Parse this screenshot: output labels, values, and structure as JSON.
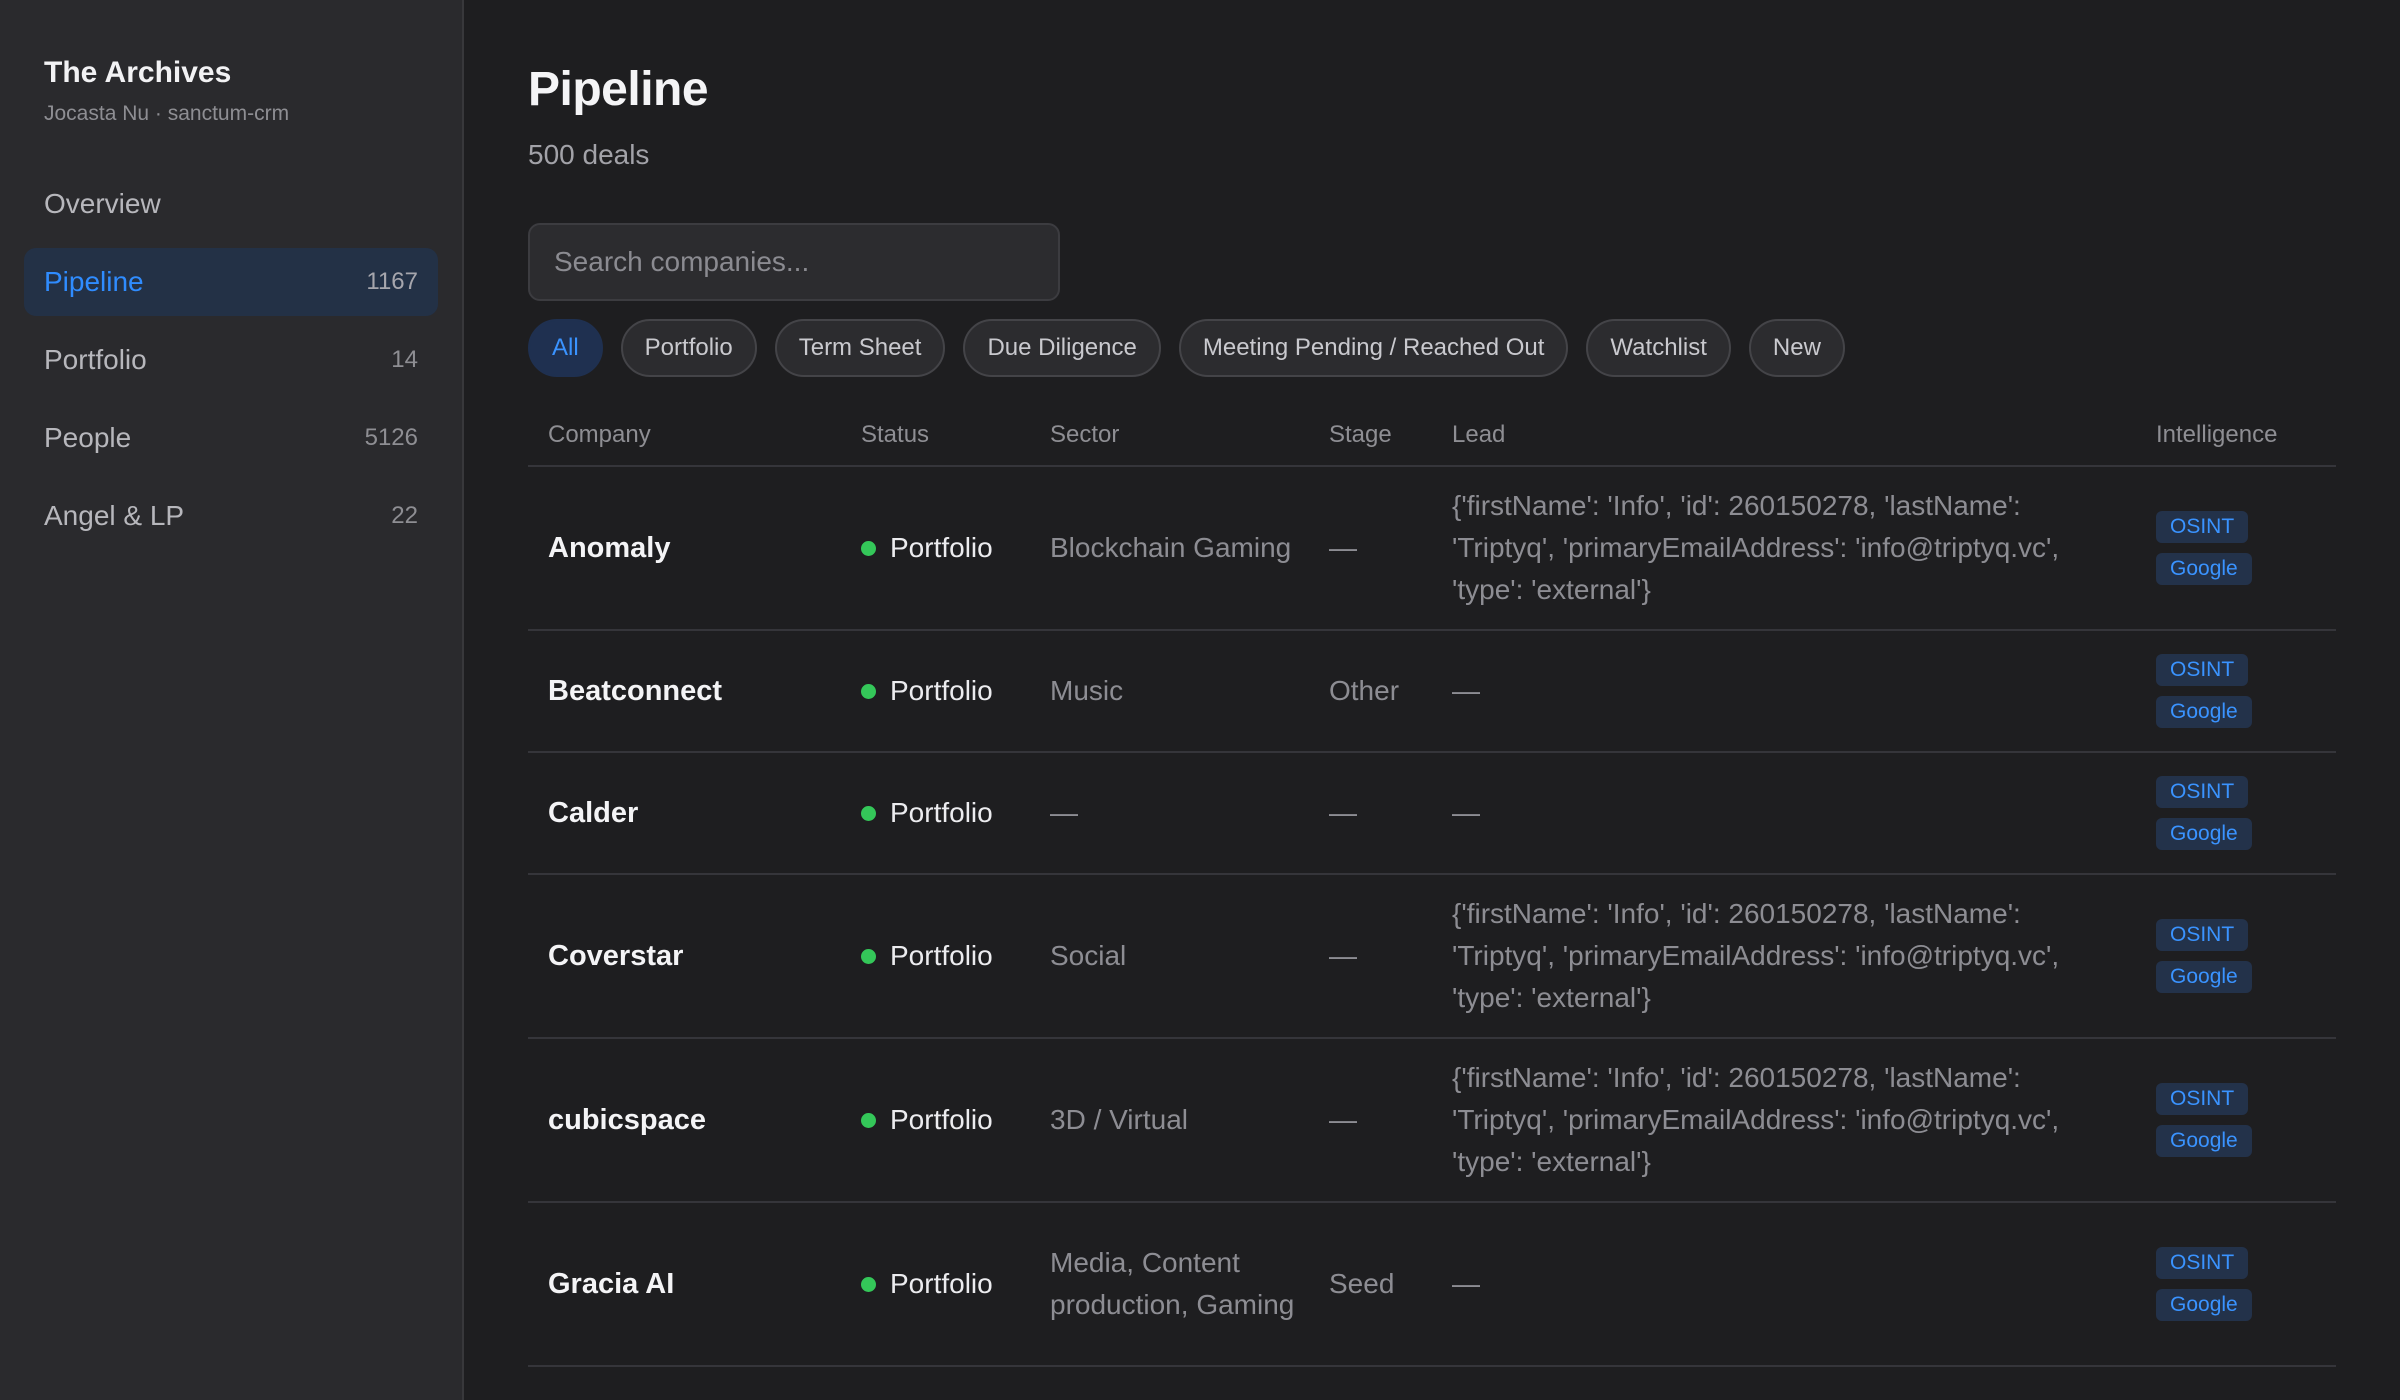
{
  "sidebar": {
    "title": "The Archives",
    "subtitle": "Jocasta Nu · sanctum-crm",
    "items": [
      {
        "label": "Overview",
        "count": ""
      },
      {
        "label": "Pipeline",
        "count": "1167"
      },
      {
        "label": "Portfolio",
        "count": "14"
      },
      {
        "label": "People",
        "count": "5126"
      },
      {
        "label": "Angel & LP",
        "count": "22"
      }
    ]
  },
  "main": {
    "title": "Pipeline",
    "subtitle": "500 deals",
    "search_placeholder": "Search companies...",
    "filters": [
      "All",
      "Portfolio",
      "Term Sheet",
      "Due Diligence",
      "Meeting Pending / Reached Out",
      "Watchlist",
      "New"
    ],
    "columns": {
      "company": "Company",
      "status": "Status",
      "sector": "Sector",
      "stage": "Stage",
      "lead": "Lead",
      "intelligence": "Intelligence"
    },
    "rows": [
      {
        "company": "Anomaly",
        "status": "Portfolio",
        "sector": "Blockchain Gaming",
        "stage": "—",
        "lead": "{'firstName': 'Info', 'id': 260150278, 'lastName': 'Triptyq', 'primaryEmailAddress': 'info@triptyq.vc', 'type': 'external'}",
        "badge1": "OSINT",
        "badge2": "Google"
      },
      {
        "company": "Beatconnect",
        "status": "Portfolio",
        "sector": "Music",
        "stage": "Other",
        "lead": "—",
        "badge1": "OSINT",
        "badge2": "Google"
      },
      {
        "company": "Calder",
        "status": "Portfolio",
        "sector": "—",
        "stage": "—",
        "lead": "—",
        "badge1": "OSINT",
        "badge2": "Google"
      },
      {
        "company": "Coverstar",
        "status": "Portfolio",
        "sector": "Social",
        "stage": "—",
        "lead": "{'firstName': 'Info', 'id': 260150278, 'lastName': 'Triptyq', 'primaryEmailAddress': 'info@triptyq.vc', 'type': 'external'}",
        "badge1": "OSINT",
        "badge2": "Google"
      },
      {
        "company": "cubicspace",
        "status": "Portfolio",
        "sector": "3D / Virtual",
        "stage": "—",
        "lead": "{'firstName': 'Info', 'id': 260150278, 'lastName': 'Triptyq', 'primaryEmailAddress': 'info@triptyq.vc', 'type': 'external'}",
        "badge1": "OSINT",
        "badge2": "Google"
      },
      {
        "company": "Gracia AI",
        "status": "Portfolio",
        "sector": "Media, Content production, Gaming",
        "stage": "Seed",
        "lead": "—",
        "badge1": "OSINT",
        "badge2": "Google"
      }
    ]
  },
  "colors": {
    "accent": "#2f8cff",
    "status_portfolio": "#34c759",
    "background": "#1e1e20",
    "sidebar_bg": "#2a2a2d"
  }
}
